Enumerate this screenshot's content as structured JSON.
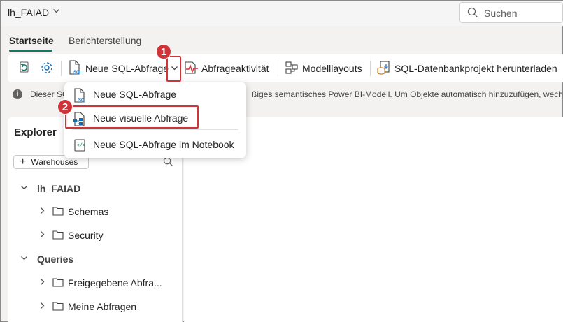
{
  "workspace": {
    "name": "lh_FAIAD",
    "chevron_icon": "chevron-down-icon"
  },
  "search": {
    "placeholder": "Suchen",
    "icon": "search-icon"
  },
  "tabs": [
    {
      "label": "Startseite",
      "active": true
    },
    {
      "label": "Berichterstellung",
      "active": false
    }
  ],
  "ribbon": {
    "refresh_icon": "refresh-icon",
    "settings_icon": "gear-icon",
    "new_sql_query": "Neue SQL-Abfrage",
    "dropdown_icon": "chevron-down-icon",
    "query_activity": "Abfrageaktivität",
    "model_layouts": "Modelllayouts",
    "download_sql_project": "SQL-Datenbankprojekt herunterladen"
  },
  "info_bar": {
    "text_left": "Dieser SC",
    "text_right": "ßiges semantisches Power BI-Modell. Um Objekte automatisch hinzuzufügen, wechseln"
  },
  "dropdown_menu": {
    "items": [
      {
        "label": "Neue SQL-Abfrage",
        "icon": "sql-file-icon"
      },
      {
        "label": "Neue visuelle Abfrage",
        "icon": "visual-query-icon"
      },
      {
        "label": "Neue SQL-Abfrage im Notebook",
        "icon": "notebook-icon"
      }
    ]
  },
  "annotations": {
    "step1": "1",
    "step2": "2",
    "highlight_color": "#d13438"
  },
  "explorer": {
    "title": "Explorer",
    "add_warehouses": "Warehouses",
    "tree": [
      {
        "label": "lh_FAIAD",
        "level": 0,
        "expanded": true
      },
      {
        "label": "Schemas",
        "level": 1,
        "expanded": false
      },
      {
        "label": "Security",
        "level": 1,
        "expanded": false
      },
      {
        "label": "Queries",
        "level": 0,
        "expanded": true
      },
      {
        "label": "Freigegebene Abfra...",
        "level": 1,
        "expanded": false
      },
      {
        "label": "Meine Abfragen",
        "level": 1,
        "expanded": false
      }
    ]
  },
  "colors": {
    "accent": "#117865",
    "highlight": "#d13438"
  }
}
